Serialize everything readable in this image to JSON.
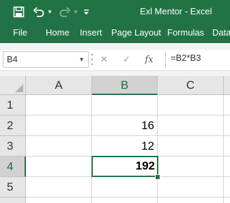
{
  "title_bar": {
    "title": "Exl Mentor  -  Excel"
  },
  "ribbon": {
    "tabs": [
      "File",
      "Home",
      "Insert",
      "Page Layout",
      "Formulas",
      "Data"
    ]
  },
  "formula_bar": {
    "name_box": "B4",
    "cancel_glyph": "✕",
    "enter_glyph": "✓",
    "fx_glyph": "fx",
    "formula": "=B2*B3"
  },
  "sheet": {
    "columns": [
      "A",
      "B",
      "C"
    ],
    "rows": [
      "1",
      "2",
      "3",
      "4",
      "5"
    ],
    "cells": {
      "B2": "16",
      "B3": "12",
      "B4": "192"
    },
    "active_cell": "B4"
  },
  "colors": {
    "excel_green": "#217346",
    "header_bg": "#e6e6e6",
    "selected_header_bg": "#d2d2d2"
  }
}
